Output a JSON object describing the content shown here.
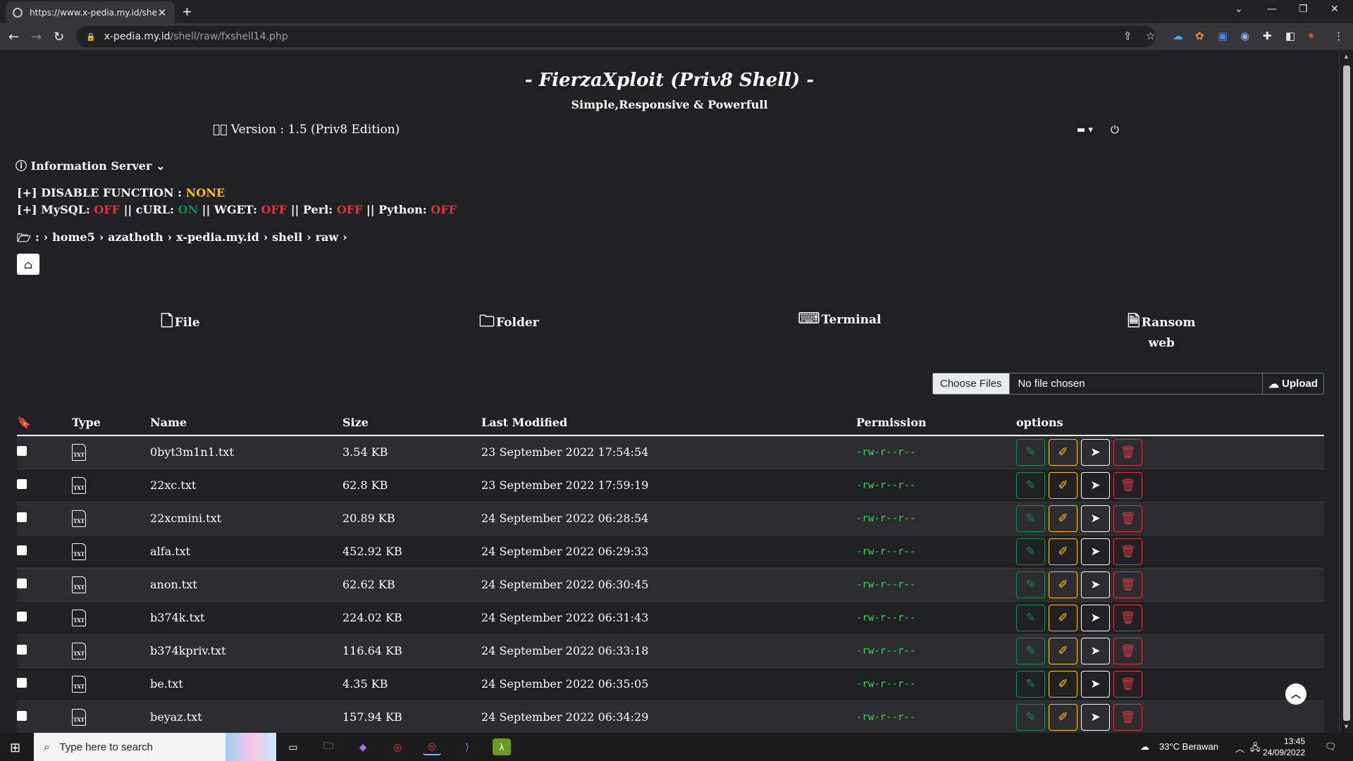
{
  "browser": {
    "tab_title": "https://www.x-pedia.my.id/shell/",
    "url_host": "x-pedia.my.id",
    "url_path": "/shell/raw/fxshell14.php"
  },
  "header": {
    "title": "- FierzaXploit (Priv8 Shell) -",
    "subtitle": "Simple,Responsive & Powerfull",
    "version": "Version : 1.5 (Priv8 Edition)"
  },
  "info": {
    "label": "Information Server",
    "disable_prefix": "[+] DISABLE FUNCTION : ",
    "disable_value": "NONE",
    "line2_prefix": "[+] MySQL: ",
    "mysql": "OFF",
    "curl_label": " || cURL: ",
    "curl": "ON",
    "wget_label": " || WGET: ",
    "wget": "OFF",
    "perl_label": " || Perl: ",
    "perl": "OFF",
    "python_label": " || Python: ",
    "python": "OFF"
  },
  "breadcrumb": {
    "prefix": ":",
    "parts": [
      "home5",
      "azathoth",
      "x-pedia.my.id",
      "shell",
      "raw"
    ]
  },
  "actions": {
    "file": "File",
    "folder": "Folder",
    "terminal": "Terminal",
    "ransom": "Ransom",
    "ransom2": "web"
  },
  "upload": {
    "choose": "Choose Files",
    "no_file": "No file chosen",
    "button": "Upload"
  },
  "table": {
    "headers": [
      "Type",
      "Name",
      "Size",
      "Last Modified",
      "Permission",
      "options"
    ],
    "rows": [
      {
        "name": "0byt3m1n1.txt",
        "size": "3.54 KB",
        "modified": "23 September 2022 17:54:54",
        "perm": "-rw-r--r--"
      },
      {
        "name": "22xc.txt",
        "size": "62.8 KB",
        "modified": "23 September 2022 17:59:19",
        "perm": "-rw-r--r--"
      },
      {
        "name": "22xcmini.txt",
        "size": "20.89 KB",
        "modified": "24 September 2022 06:28:54",
        "perm": "-rw-r--r--"
      },
      {
        "name": "alfa.txt",
        "size": "452.92 KB",
        "modified": "24 September 2022 06:29:33",
        "perm": "-rw-r--r--"
      },
      {
        "name": "anon.txt",
        "size": "62.62 KB",
        "modified": "24 September 2022 06:30:45",
        "perm": "-rw-r--r--"
      },
      {
        "name": "b374k.txt",
        "size": "224.02 KB",
        "modified": "24 September 2022 06:31:43",
        "perm": "-rw-r--r--"
      },
      {
        "name": "b374kpriv.txt",
        "size": "116.64 KB",
        "modified": "24 September 2022 06:33:18",
        "perm": "-rw-r--r--"
      },
      {
        "name": "be.txt",
        "size": "4.35 KB",
        "modified": "24 September 2022 06:35:05",
        "perm": "-rw-r--r--"
      },
      {
        "name": "beyaz.txt",
        "size": "157.94 KB",
        "modified": "24 September 2022 06:34:29",
        "perm": "-rw-r--r--"
      }
    ]
  },
  "taskbar": {
    "search_placeholder": "Type here to search",
    "weather": "33°C  Berawan",
    "time": "13:45",
    "date": "24/09/2022"
  },
  "colors": {
    "accent_green": "#198754",
    "accent_yellow": "#ffc107",
    "accent_red": "#dc3545",
    "bg": "#202124"
  }
}
